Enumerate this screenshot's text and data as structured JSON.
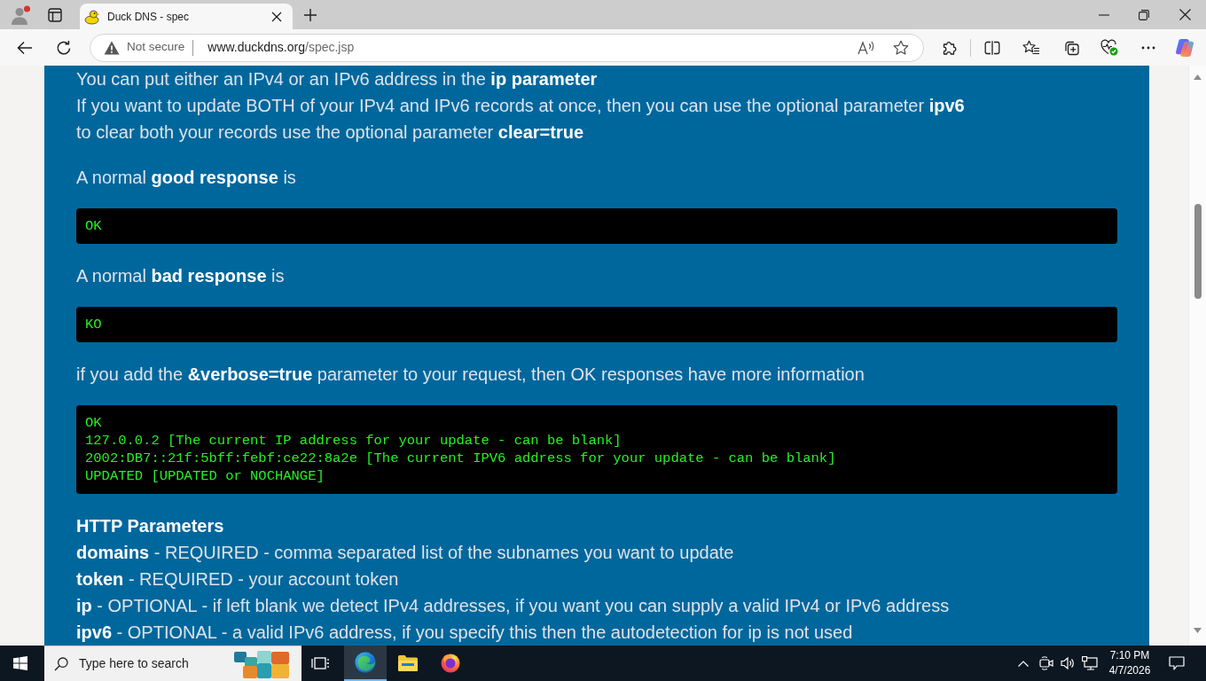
{
  "browser": {
    "tabs": [
      {
        "title": "Duck DNS - spec",
        "selected": true
      }
    ],
    "address": {
      "security": "Not secure",
      "host": "www.duckdns.org",
      "path": "/spec.jsp"
    }
  },
  "page": {
    "blocks": [
      {
        "kind": "paragraph",
        "lines": [
          "You can put either an IPv4 or an IPv6 address in the **ip parameter**",
          "If you want to update BOTH of your IPv4 and IPv6 records at once, then you can use the optional parameter **ipv6**",
          "to clear both your records use the optional parameter **clear=true**"
        ]
      },
      {
        "kind": "paragraph",
        "lines": [
          "A normal **good response** is"
        ]
      },
      {
        "kind": "code",
        "lines": [
          "OK"
        ]
      },
      {
        "kind": "paragraph",
        "lines": [
          "A normal **bad response** is"
        ]
      },
      {
        "kind": "code",
        "lines": [
          "KO"
        ]
      },
      {
        "kind": "paragraph",
        "lines": [
          "if you add the **&verbose=true** parameter to your request, then OK responses have more information"
        ]
      },
      {
        "kind": "code",
        "lines": [
          "OK",
          "127.0.0.2 [The current IP address for your update - can be blank]",
          "2002:DB7::21f:5bff:febf:ce22:8a2e [The current IPV6 address for your update - can be blank]",
          "UPDATED [UPDATED or NOCHANGE]"
        ]
      },
      {
        "kind": "heading",
        "text": "HTTP Parameters"
      },
      {
        "kind": "paragraph",
        "lines": [
          "**domains** - REQUIRED - comma separated list of the subnames you want to update",
          "**token** - REQUIRED - your account token",
          "**ip** - OPTIONAL - if left blank we detect IPv4 addresses, if you want you can supply a valid IPv4 or IPv6 address",
          "**ipv6** - OPTIONAL - a valid IPv6 address, if you specify this then the autodetection for ip is not used"
        ]
      }
    ]
  },
  "taskbar": {
    "search": {
      "placeholder": "Type here to search"
    },
    "apps": [
      {
        "kind": "edge",
        "selected": true
      },
      {
        "kind": "files",
        "selected": false
      },
      {
        "kind": "firefox",
        "selected": false
      }
    ],
    "clock": {
      "time": "7:10 PM",
      "date": "4/7/2026"
    }
  }
}
